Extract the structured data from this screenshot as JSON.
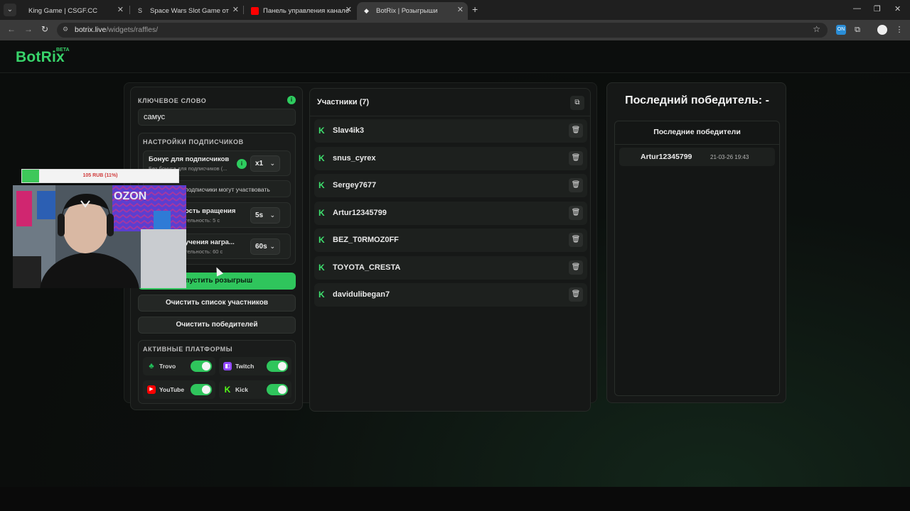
{
  "browser": {
    "tabs": [
      {
        "title": "King Game | CSGF.CC",
        "active": false
      },
      {
        "title": "Space Wars Slot Game от Neter",
        "active": false
      },
      {
        "title": "Панель управления каналом",
        "active": false
      },
      {
        "title": "BotRix | Розыгрыши",
        "active": true
      }
    ],
    "url_host": "botrix.live",
    "url_path": "/widgets/raffles/"
  },
  "header": {
    "logo": "BotRix",
    "beta": "BETA"
  },
  "settings": {
    "keyword_label": "КЛЮЧЕВОЕ СЛОВО",
    "keyword_value": "самус",
    "subs_title": "НАСТРОЙКИ ПОДПИСЧИКОВ",
    "sub_bonus_title": "Бонус для подписчиков",
    "sub_bonus_desc": "Без бонуса для подписчиков (...",
    "sub_bonus_value": "x1",
    "subs_only": "подписчики могут участвовать",
    "spin_title": "ость вращения",
    "spin_desc": "тельность: 5 с",
    "spin_value": "5s",
    "claim_title": "учения награ...",
    "claim_desc": "тельность: 60 с",
    "claim_value": "60s",
    "start_button": "апустить розыгрыш",
    "clear_participants": "Очистить список участников",
    "clear_winners": "Очистить победителей",
    "platforms_title": "АКТИВНЫЕ ПЛАТФОРМЫ",
    "platforms": [
      {
        "name": "Trovo",
        "enabled": true,
        "color": "#21c35b"
      },
      {
        "name": "Twitch",
        "enabled": true,
        "color": "#9146ff"
      },
      {
        "name": "YouTube",
        "enabled": true,
        "color": "#ff0000"
      },
      {
        "name": "Kick",
        "enabled": true,
        "color": "#53fc18"
      }
    ]
  },
  "participants": {
    "title": "Участники (7)",
    "list": [
      "Slav4ik3",
      "snus_cyrex",
      "Sergey7677",
      "Artur12345799",
      "BEZ_T0RMOZ0FF",
      "TOYOTA_CRESTA",
      "davidulibegan7"
    ]
  },
  "winners": {
    "last_winner": "Последний победитель: -",
    "recent_title": "Последние победители",
    "recent": [
      {
        "name": "Artur12345799",
        "date": "21-03-26 19:43"
      }
    ]
  },
  "overlay": {
    "progress_text": "105 RUB (11%)",
    "progress": 0.11,
    "cam_sign": "OZON"
  }
}
